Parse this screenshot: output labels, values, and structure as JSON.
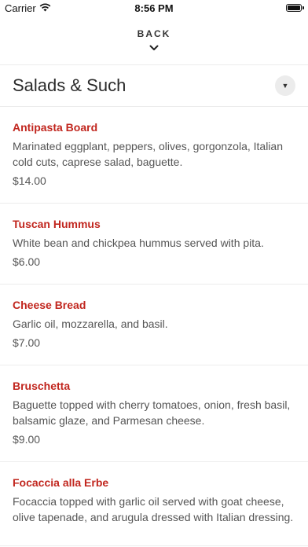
{
  "status_bar": {
    "carrier": "Carrier",
    "time": "8:56 PM",
    "wifi_icon": "wifi-icon",
    "battery_icon": "battery-icon"
  },
  "nav": {
    "back_label": "BACK",
    "chevron_icon": "chevron-down-icon"
  },
  "section": {
    "title": "Salads & Such",
    "dropdown_icon": "caret-down-icon"
  },
  "items": [
    {
      "name": "Antipasta Board",
      "description": "Marinated eggplant, peppers, olives, gorgonzola, Italian cold cuts, caprese salad, baguette.",
      "price": "$14.00"
    },
    {
      "name": "Tuscan Hummus",
      "description": "White bean and chickpea hummus served with pita.",
      "price": "$6.00"
    },
    {
      "name": "Cheese Bread",
      "description": "Garlic oil, mozzarella, and basil.",
      "price": "$7.00"
    },
    {
      "name": "Bruschetta",
      "description": "Baguette topped with cherry tomatoes, onion, fresh basil, balsamic glaze, and Parmesan cheese.",
      "price": "$9.00"
    },
    {
      "name": "Focaccia alla Erbe",
      "description": "Focaccia topped with garlic oil served with goat cheese, olive tapenade, and arugula dressed with Italian dressing.",
      "price": ""
    }
  ],
  "colors": {
    "accent": "#c1261e",
    "divider": "#ececec"
  }
}
